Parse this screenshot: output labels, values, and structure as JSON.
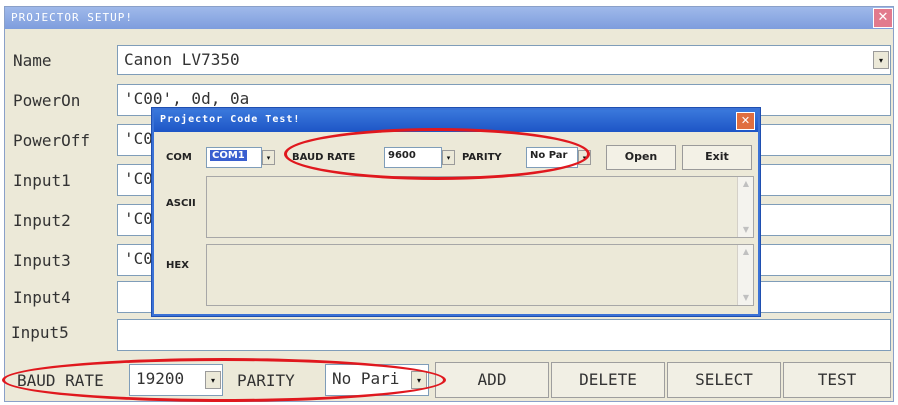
{
  "main": {
    "title": "PROJECTOR SETUP!",
    "close_glyph": "✕",
    "fields": [
      {
        "label": "Name",
        "value": "Canon LV7350"
      },
      {
        "label": "PowerOn",
        "value": "'C00', 0d, 0a"
      },
      {
        "label": "PowerOff",
        "value": "'C0"
      },
      {
        "label": "Input1",
        "value": "'C0"
      },
      {
        "label": "Input2",
        "value": "'C0"
      },
      {
        "label": "Input3",
        "value": "'C0"
      },
      {
        "label": "Input4",
        "value": ""
      },
      {
        "label": "Input5",
        "value": ""
      }
    ],
    "name_dropdown_glyph": "▾",
    "bottom": {
      "baud_label": "BAUD RATE",
      "baud_value": "19200",
      "parity_label": "PARITY",
      "parity_value": "No Pari",
      "buttons": {
        "add": "ADD",
        "delete": "DELETE",
        "select": "SELECT",
        "test": "TEST"
      }
    }
  },
  "dialog": {
    "title": "Projector Code Test!",
    "close_glyph": "✕",
    "com_label": "COM",
    "com_value": "COM1",
    "baud_label": "BAUD RATE",
    "baud_value": "9600",
    "parity_label": "PARITY",
    "parity_value": "No Par",
    "open_label": "Open",
    "exit_label": "Exit",
    "ascii_label": "ASCII",
    "hex_label": "HEX"
  },
  "colors": {
    "annotation": "#e0181e",
    "dialog_title": "#2a63cf",
    "main_title": "#8faae4"
  }
}
